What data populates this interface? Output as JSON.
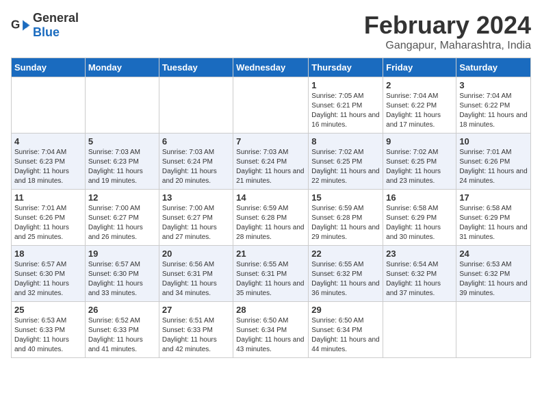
{
  "logo": {
    "general": "General",
    "blue": "Blue"
  },
  "title": "February 2024",
  "subtitle": "Gangapur, Maharashtra, India",
  "days_of_week": [
    "Sunday",
    "Monday",
    "Tuesday",
    "Wednesday",
    "Thursday",
    "Friday",
    "Saturday"
  ],
  "weeks": [
    [
      {
        "day": "",
        "info": ""
      },
      {
        "day": "",
        "info": ""
      },
      {
        "day": "",
        "info": ""
      },
      {
        "day": "",
        "info": ""
      },
      {
        "day": "1",
        "info": "Sunrise: 7:05 AM\nSunset: 6:21 PM\nDaylight: 11 hours and 16 minutes."
      },
      {
        "day": "2",
        "info": "Sunrise: 7:04 AM\nSunset: 6:22 PM\nDaylight: 11 hours and 17 minutes."
      },
      {
        "day": "3",
        "info": "Sunrise: 7:04 AM\nSunset: 6:22 PM\nDaylight: 11 hours and 18 minutes."
      }
    ],
    [
      {
        "day": "4",
        "info": "Sunrise: 7:04 AM\nSunset: 6:23 PM\nDaylight: 11 hours and 18 minutes."
      },
      {
        "day": "5",
        "info": "Sunrise: 7:03 AM\nSunset: 6:23 PM\nDaylight: 11 hours and 19 minutes."
      },
      {
        "day": "6",
        "info": "Sunrise: 7:03 AM\nSunset: 6:24 PM\nDaylight: 11 hours and 20 minutes."
      },
      {
        "day": "7",
        "info": "Sunrise: 7:03 AM\nSunset: 6:24 PM\nDaylight: 11 hours and 21 minutes."
      },
      {
        "day": "8",
        "info": "Sunrise: 7:02 AM\nSunset: 6:25 PM\nDaylight: 11 hours and 22 minutes."
      },
      {
        "day": "9",
        "info": "Sunrise: 7:02 AM\nSunset: 6:25 PM\nDaylight: 11 hours and 23 minutes."
      },
      {
        "day": "10",
        "info": "Sunrise: 7:01 AM\nSunset: 6:26 PM\nDaylight: 11 hours and 24 minutes."
      }
    ],
    [
      {
        "day": "11",
        "info": "Sunrise: 7:01 AM\nSunset: 6:26 PM\nDaylight: 11 hours and 25 minutes."
      },
      {
        "day": "12",
        "info": "Sunrise: 7:00 AM\nSunset: 6:27 PM\nDaylight: 11 hours and 26 minutes."
      },
      {
        "day": "13",
        "info": "Sunrise: 7:00 AM\nSunset: 6:27 PM\nDaylight: 11 hours and 27 minutes."
      },
      {
        "day": "14",
        "info": "Sunrise: 6:59 AM\nSunset: 6:28 PM\nDaylight: 11 hours and 28 minutes."
      },
      {
        "day": "15",
        "info": "Sunrise: 6:59 AM\nSunset: 6:28 PM\nDaylight: 11 hours and 29 minutes."
      },
      {
        "day": "16",
        "info": "Sunrise: 6:58 AM\nSunset: 6:29 PM\nDaylight: 11 hours and 30 minutes."
      },
      {
        "day": "17",
        "info": "Sunrise: 6:58 AM\nSunset: 6:29 PM\nDaylight: 11 hours and 31 minutes."
      }
    ],
    [
      {
        "day": "18",
        "info": "Sunrise: 6:57 AM\nSunset: 6:30 PM\nDaylight: 11 hours and 32 minutes."
      },
      {
        "day": "19",
        "info": "Sunrise: 6:57 AM\nSunset: 6:30 PM\nDaylight: 11 hours and 33 minutes."
      },
      {
        "day": "20",
        "info": "Sunrise: 6:56 AM\nSunset: 6:31 PM\nDaylight: 11 hours and 34 minutes."
      },
      {
        "day": "21",
        "info": "Sunrise: 6:55 AM\nSunset: 6:31 PM\nDaylight: 11 hours and 35 minutes."
      },
      {
        "day": "22",
        "info": "Sunrise: 6:55 AM\nSunset: 6:32 PM\nDaylight: 11 hours and 36 minutes."
      },
      {
        "day": "23",
        "info": "Sunrise: 6:54 AM\nSunset: 6:32 PM\nDaylight: 11 hours and 37 minutes."
      },
      {
        "day": "24",
        "info": "Sunrise: 6:53 AM\nSunset: 6:32 PM\nDaylight: 11 hours and 39 minutes."
      }
    ],
    [
      {
        "day": "25",
        "info": "Sunrise: 6:53 AM\nSunset: 6:33 PM\nDaylight: 11 hours and 40 minutes."
      },
      {
        "day": "26",
        "info": "Sunrise: 6:52 AM\nSunset: 6:33 PM\nDaylight: 11 hours and 41 minutes."
      },
      {
        "day": "27",
        "info": "Sunrise: 6:51 AM\nSunset: 6:33 PM\nDaylight: 11 hours and 42 minutes."
      },
      {
        "day": "28",
        "info": "Sunrise: 6:50 AM\nSunset: 6:34 PM\nDaylight: 11 hours and 43 minutes."
      },
      {
        "day": "29",
        "info": "Sunrise: 6:50 AM\nSunset: 6:34 PM\nDaylight: 11 hours and 44 minutes."
      },
      {
        "day": "",
        "info": ""
      },
      {
        "day": "",
        "info": ""
      }
    ]
  ]
}
